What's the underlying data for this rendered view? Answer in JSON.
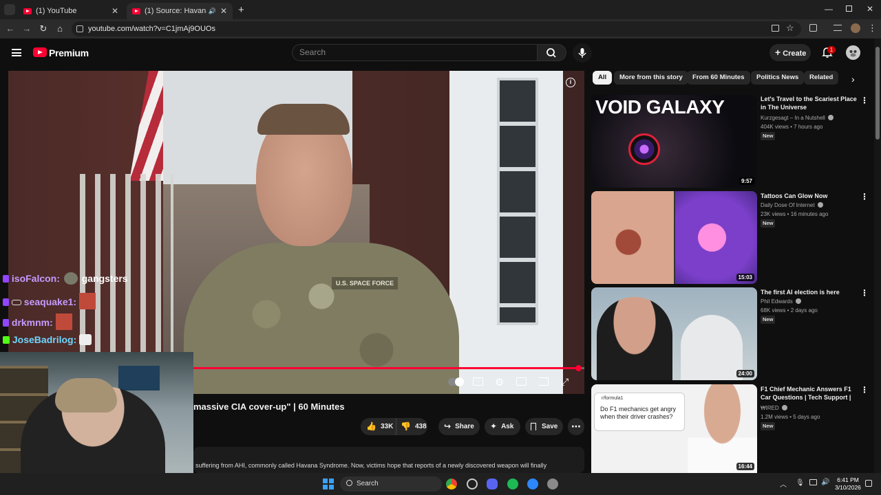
{
  "browser": {
    "tabs": [
      {
        "title": "(1) YouTube",
        "active": false
      },
      {
        "title": "(1) Source: Havana Syndrome",
        "active": true
      }
    ],
    "url": "youtube.com/watch?v=C1jmAj9OUOs",
    "window_controls": [
      "minimize",
      "restore",
      "close"
    ]
  },
  "youtube": {
    "brand": "Premium",
    "search_placeholder": "Search",
    "create_label": "Create",
    "notification_count": "1"
  },
  "video": {
    "title_visible": "massive CIA cover-up\" | 60 Minutes",
    "progress": 0.99,
    "overlay_patch": "U.S. SPACE FORCE",
    "controls": [
      "autoplay-toggle",
      "captions",
      "settings",
      "theater",
      "cast",
      "fullscreen"
    ],
    "actions": {
      "likes": "33K",
      "dislikes": "438",
      "share": "Share",
      "ask": "Ask",
      "save": "Save"
    },
    "description_snippet": "suffering from AHI, commonly called Havana Syndrome. Now, victims hope that reports of a newly discovered weapon will finally"
  },
  "chat": [
    {
      "name": "isoFalcon:",
      "msg": "gangsters"
    },
    {
      "name": "seaquake1:",
      "msg": ""
    },
    {
      "name": "drkmnm:",
      "msg": ""
    },
    {
      "name": "JoseBadrilog:",
      "msg": ""
    }
  ],
  "chips": [
    "All",
    "More from this story",
    "From 60 Minutes",
    "Politics News",
    "Related"
  ],
  "recommendations": [
    {
      "title": "Let's Travel to the Scariest Place in The Universe",
      "channel": "Kurzgesagt – In a Nutshell",
      "meta": "404K views • 7 hours ago",
      "badge": "New",
      "duration": "9:57",
      "thumb_text": "VOID GALAXY"
    },
    {
      "title": "Tattoos Can Glow Now",
      "channel": "Daily Dose Of Internet",
      "meta": "23K views • 16 minutes ago",
      "badge": "New",
      "duration": "15:03"
    },
    {
      "title": "The first AI election is here",
      "channel": "Phil Edwards",
      "meta": "68K views • 2 days ago",
      "badge": "New",
      "duration": "24:00"
    },
    {
      "title": "F1 Chief Mechanic Answers F1 Car Questions | Tech Support | ...",
      "channel": "WIRED",
      "meta": "1.2M views • 5 days ago",
      "badge": "New",
      "duration": "16:44",
      "thumb_sub": "r/formula1",
      "thumb_text": "Do F1 mechanics get angry when their driver crashes?"
    }
  ],
  "taskbar": {
    "search_label": "Search",
    "time": "6:41 PM",
    "date": "3/10/2026"
  },
  "colors": {
    "accent": "#ff0033",
    "background": "#0f0f0f",
    "progress": "#ff0033"
  }
}
